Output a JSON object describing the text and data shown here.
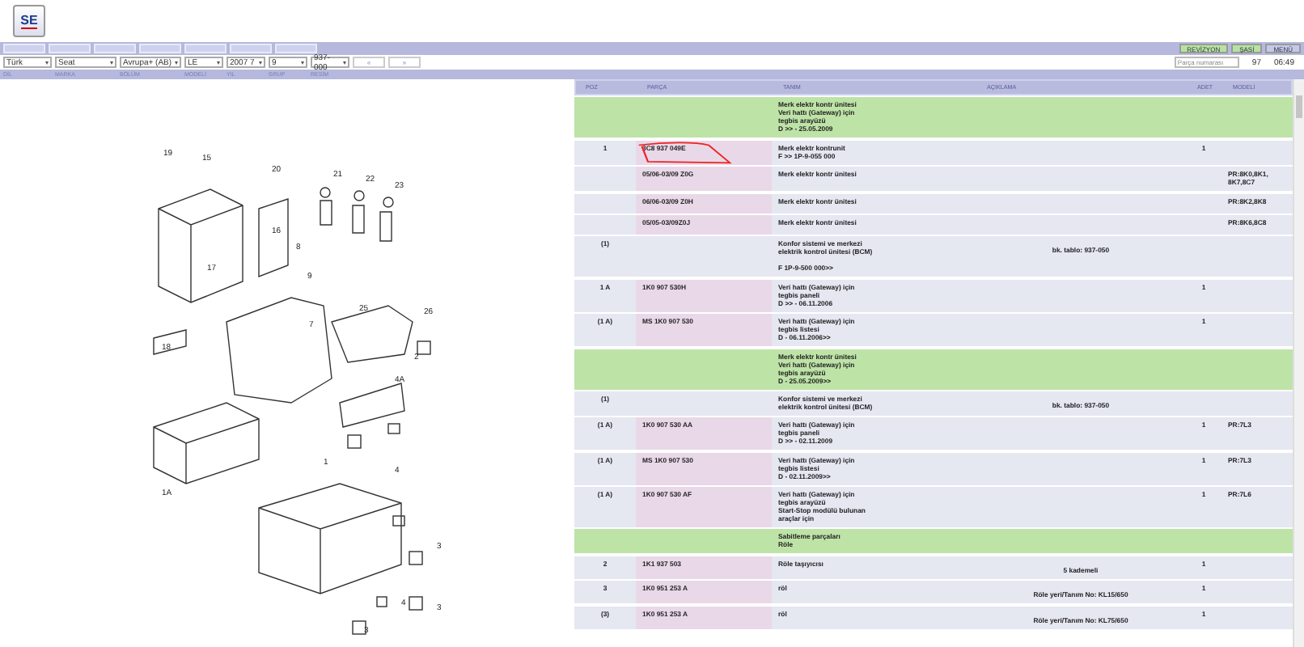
{
  "logo": {
    "text": "SE"
  },
  "filters": [
    {
      "label": "DİL",
      "value": "Türk"
    },
    {
      "label": "MARKA",
      "value": "Seat"
    },
    {
      "label": "BÖLÜM",
      "value": "Avrupa+ (AB)"
    },
    {
      "label": "MODELİ",
      "value": "LE"
    },
    {
      "label": "YIL",
      "value": "2007 7"
    },
    {
      "label": "GRUP",
      "value": "9"
    },
    {
      "label": "RESİM",
      "value": "937-000"
    }
  ],
  "nav_buttons": [
    "«",
    "»"
  ],
  "right_buttons": [
    {
      "label": "REVİZYON",
      "highlighted": true
    },
    {
      "label": "ŞASİ",
      "highlighted": true
    },
    {
      "label": "MENÜ",
      "highlighted": false
    }
  ],
  "search": {
    "placeholder": "Parça numarası"
  },
  "page": "97",
  "time": "06:49",
  "diagram": {
    "callouts": [
      "19",
      "15",
      "20",
      "21",
      "22",
      "23",
      "16",
      "8",
      "17",
      "9",
      "25",
      "26",
      "7",
      "18",
      "2",
      "4A",
      "1",
      "4",
      "1A",
      "3",
      "4",
      "3",
      "3"
    ]
  },
  "table": {
    "columns": [
      "POZ",
      "PARÇA",
      "TANIM",
      "AÇIKLAMA",
      "ADET",
      "MODELİ"
    ],
    "rows": [
      {
        "kind": "group",
        "desc": "Merk elektr kontr ünitesi\nVeri hattı (Gateway) için\ntegbis arayüzü\nD >> - 25.05.2009"
      },
      {
        "kind": "part",
        "poz": "1",
        "part": "3C8 937 049E",
        "desc": "Merk elektr kontrunit\nF >> 1P-9-055 000",
        "qty": "1",
        "marked": true
      },
      {
        "kind": "part",
        "part": "05/06-03/09 Z0G",
        "desc": "Merk elektr kontr ünitesi",
        "model": "PR:8K0,8K1,\n8K7,8C7",
        "marked": false
      },
      {
        "kind": "part",
        "part": "06/06-03/09 Z0H",
        "desc": "Merk elektr kontr ünitesi",
        "model": "PR:8K2,8K8",
        "marked": false
      },
      {
        "kind": "part",
        "part": "05/05-03/09Z0J",
        "desc": "Merk elektr kontr ünitesi",
        "model": "PR:8K6,8C8",
        "marked": false
      },
      {
        "kind": "info",
        "poz": "(1)",
        "desc": "Konfor sistemi ve merkezi\nelektrik kontrol ünitesi (BCM)\n\nF 1P-9-500 000>>",
        "note": "bk. tablo: 937-050"
      },
      {
        "kind": "part",
        "poz": "1 A",
        "part": "1K0 907 530H",
        "desc": "Veri hattı (Gateway) için\ntegbis paneli\nD >> - 06.11.2006",
        "qty": "1",
        "marked": false
      },
      {
        "kind": "part",
        "poz": "(1 A)",
        "part": "MS 1K0 907 530",
        "desc": "Veri hattı (Gateway) için\ntegbis listesi\nD - 06.11.2006>>",
        "qty": "1",
        "marked": false
      },
      {
        "kind": "group",
        "desc": "Merk elektr kontr ünitesi\nVeri hattı (Gateway) için\ntegbis arayüzü\nD - 25.05.2009>>"
      },
      {
        "kind": "info",
        "poz": "(1)",
        "desc": "Konfor sistemi ve merkezi\nelektrik kontrol ünitesi (BCM)",
        "note": "bk. tablo: 937-050"
      },
      {
        "kind": "part",
        "poz": "(1 A)",
        "part": "1K0 907 530 AA",
        "desc": "Veri hattı (Gateway) için\ntegbis paneli\nD >> - 02.11.2009",
        "qty": "1",
        "model": "PR:7L3",
        "marked": false
      },
      {
        "kind": "part",
        "poz": "(1 A)",
        "part": "MS 1K0 907 530",
        "desc": "Veri hattı (Gateway) için\ntegbis listesi\nD - 02.11.2009>>",
        "qty": "1",
        "model": "PR:7L3",
        "marked": false
      },
      {
        "kind": "part",
        "poz": "(1 A)",
        "part": "1K0 907 530 AF",
        "desc": "Veri hattı (Gateway) için\ntegbis arayüzü\nStart-Stop modülü bulunan\naraçlar için",
        "qty": "1",
        "model": "PR:7L6",
        "marked": false
      },
      {
        "kind": "group",
        "desc": "Sabitleme parçaları\nRöle"
      },
      {
        "kind": "part",
        "poz": "2",
        "part": "1K1 937 503",
        "desc": "Röle taşıyıcısı",
        "note": "5 kademeli",
        "qty": "1",
        "marked": false
      },
      {
        "kind": "part",
        "poz": "3",
        "part": "1K0 951 253 A",
        "desc": "röl",
        "note": "Röle yeri/Tanım No: KL15/650",
        "qty": "1",
        "marked": false
      },
      {
        "kind": "part",
        "poz": "(3)",
        "part": "1K0 951 253 A",
        "desc": "röl",
        "note": "Röle yeri/Tanım No: KL75/650",
        "qty": "1",
        "marked": false
      }
    ]
  }
}
